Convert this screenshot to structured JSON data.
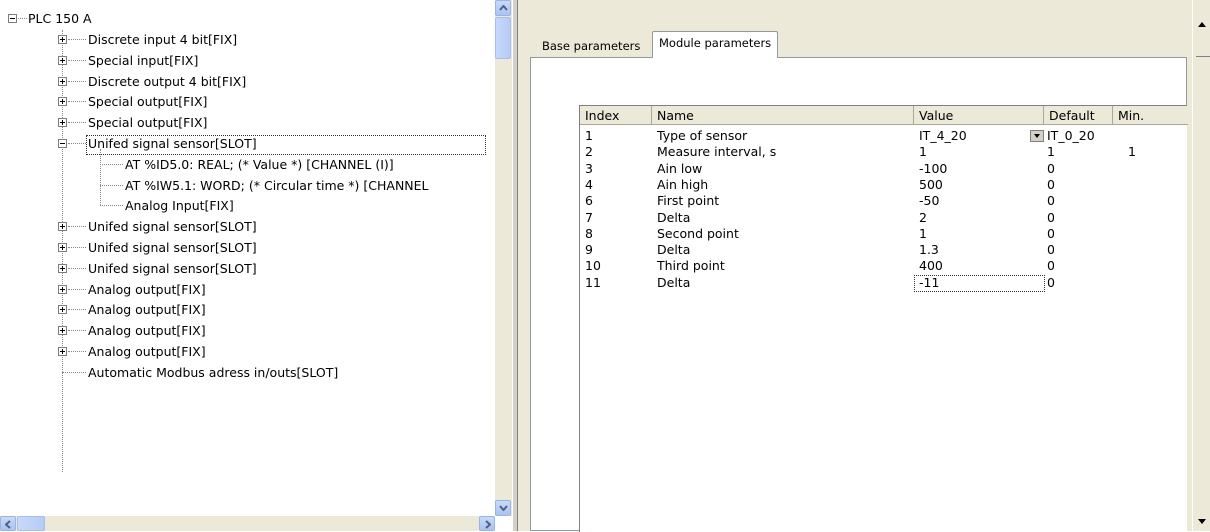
{
  "tree": {
    "root_label": "PLC 150 A",
    "items": [
      {
        "label": "Discrete input 4 bit[FIX]",
        "expander": "plus"
      },
      {
        "label": "Special input[FIX]",
        "expander": "plus"
      },
      {
        "label": "Discrete output 4 bit[FIX]",
        "expander": "plus"
      },
      {
        "label": "Special output[FIX]",
        "expander": "plus"
      },
      {
        "label": "Special output[FIX]",
        "expander": "plus"
      },
      {
        "label": "Unifed signal sensor[SLOT]",
        "expander": "minus",
        "selected": true
      },
      {
        "label": "AT %ID5.0: REAL; (* Value *) [CHANNEL (I)]",
        "child": true
      },
      {
        "label": "AT %IW5.1: WORD; (* Circular time *) [CHANNEL",
        "child": true
      },
      {
        "label": "Analog Input[FIX]",
        "child": true
      },
      {
        "label": "Unifed signal sensor[SLOT]",
        "expander": "plus"
      },
      {
        "label": "Unifed signal sensor[SLOT]",
        "expander": "plus"
      },
      {
        "label": "Unifed signal sensor[SLOT]",
        "expander": "plus"
      },
      {
        "label": "Analog output[FIX]",
        "expander": "plus"
      },
      {
        "label": "Analog output[FIX]",
        "expander": "plus"
      },
      {
        "label": "Analog output[FIX]",
        "expander": "plus"
      },
      {
        "label": "Analog output[FIX]",
        "expander": "plus"
      },
      {
        "label": "Automatic Modbus adress in/outs[SLOT]",
        "expander": "none"
      }
    ]
  },
  "tabs": [
    {
      "label": "Base parameters",
      "active": false
    },
    {
      "label": "Module parameters",
      "active": true
    }
  ],
  "grid": {
    "columns": [
      "Index",
      "Name",
      "Value",
      "Default",
      "Min."
    ],
    "rows": [
      {
        "index": "1",
        "name": "Type of sensor",
        "value": "IT_4_20",
        "default": "IT_0_20",
        "min": "",
        "dropdown": true
      },
      {
        "index": "2",
        "name": "Measure interval, s",
        "value": "1",
        "default": "1",
        "min": "1"
      },
      {
        "index": "3",
        "name": "Ain low",
        "value": "-100",
        "default": "0",
        "min": ""
      },
      {
        "index": "4",
        "name": "Ain high",
        "value": "500",
        "default": "0",
        "min": ""
      },
      {
        "index": "6",
        "name": "First point",
        "value": "-50",
        "default": "0",
        "min": ""
      },
      {
        "index": "7",
        "name": "Delta",
        "value": "2",
        "default": "0",
        "min": ""
      },
      {
        "index": "8",
        "name": "Second point",
        "value": "1",
        "default": "0",
        "min": ""
      },
      {
        "index": "9",
        "name": "Delta",
        "value": "1.3",
        "default": "0",
        "min": ""
      },
      {
        "index": "10",
        "name": "Third point",
        "value": "400",
        "default": "0",
        "min": ""
      },
      {
        "index": "11",
        "name": "Delta",
        "value": "-11",
        "default": "0",
        "min": "",
        "focused": true
      }
    ]
  },
  "icons": {
    "tree_expand": "plus-box-icon",
    "tree_collapse": "minus-box-icon",
    "scroll_up": "arrow-up-icon",
    "scroll_down": "arrow-down-icon",
    "scroll_left": "arrow-left-icon",
    "scroll_right": "arrow-right-icon",
    "dropdown": "chevron-down-icon"
  }
}
